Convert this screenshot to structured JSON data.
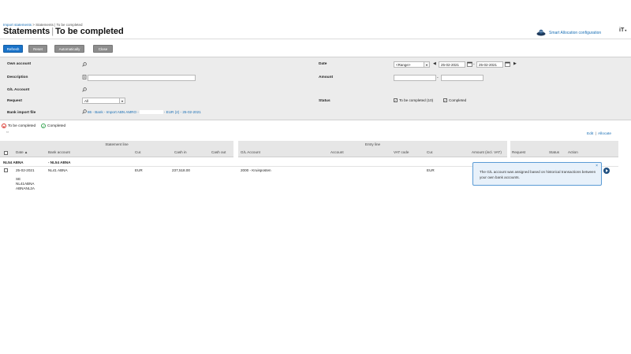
{
  "breadcrumb": {
    "link": "Import statements",
    "rest": "> Statements | To be completed"
  },
  "page": {
    "title_main": "Statements",
    "title_sep": "|",
    "title_sub": "To be completed"
  },
  "header": {
    "smart_allocation": "Smart Allocation configuration",
    "user_initials": "iT"
  },
  "toolbar": {
    "refresh": "Refresh",
    "reset": "Reset",
    "automatically": "Automatically",
    "close": "Close"
  },
  "filters": {
    "own_account_label": "Own account",
    "description_label": "Description",
    "gl_account_label": "G/L Account",
    "request_label": "Request",
    "request_value": "All",
    "bank_import_label": "Bank import file",
    "bank_import_value": "86 - Bank - Import ABN AMRO -",
    "bank_import_value_2": "- EUR (2) - 25-02-2021",
    "date_label": "Date",
    "date_range": "<Range>",
    "date_from": "25-02-2021",
    "date_to": "25-02-2021",
    "date_dash": "-",
    "amount_label": "Amount",
    "amount_dash": "-",
    "status_label": "Status",
    "status_to_be_completed": "To be completed (10)",
    "status_completed": "Completed"
  },
  "legend": {
    "to_be_completed": "To be completed",
    "completed": "Completed"
  },
  "actions": {
    "edit": "Edit",
    "sep": "|",
    "allocate": "Allocate"
  },
  "table": {
    "group_statement": "Statement line",
    "group_entry": "Entry line",
    "headers": {
      "date": "Date",
      "bank_account": "Bank account",
      "cur": "Cur.",
      "cash_in": "Cash in",
      "cash_out": "Cash out",
      "gl_account": "G/L Account",
      "account": "Account",
      "vat_code": "VAT code",
      "cur2": "Cur.",
      "amount_incl_vat": "Amount (incl. VAT)",
      "request": "Request",
      "status": "Status",
      "action": "Action"
    },
    "group_row": {
      "left": "NL54 ABNA",
      "right": "- NL54 ABNA"
    },
    "rows": [
      {
        "date": "25-02-2021",
        "bank_account": "NL41 ABNA",
        "cur": "EUR",
        "cash_in": "237,518.00",
        "gl_account": "2000 - Kruisposten",
        "cur2": "EUR",
        "desc_1": "SE",
        "desc_2": "NL41ABNA",
        "desc_3": "ABNANL2A"
      }
    ]
  },
  "tooltip": {
    "text": "The G/L account was assigned based on historical transactions between your own bank accounts.",
    "close": "×"
  },
  "colors": {
    "accent": "#1a73c9",
    "link": "#1a6fb5",
    "status_open": "#d9342b",
    "status_done": "#3aa655"
  }
}
